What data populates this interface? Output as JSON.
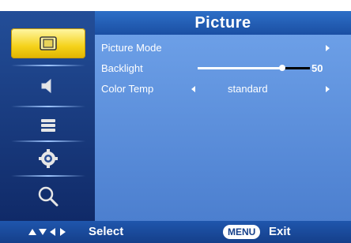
{
  "header": {
    "title": "Picture"
  },
  "sidebar": {
    "items": [
      {
        "icon": "picture-icon",
        "active": true
      },
      {
        "icon": "speaker-icon",
        "active": false
      },
      {
        "icon": "settings-bars-icon",
        "active": false
      },
      {
        "icon": "gear-icon",
        "active": false
      },
      {
        "icon": "search-icon",
        "active": false
      }
    ]
  },
  "menu": {
    "items": [
      {
        "label": "Picture Mode"
      },
      {
        "label": "Backlight",
        "value": "50",
        "level": 0.75
      },
      {
        "label": "Color Temp",
        "value": "standard"
      }
    ]
  },
  "footer": {
    "select_label": "Select",
    "menu_key": "MENU",
    "exit_label": "Exit"
  },
  "colors": {
    "panel": "#5a8fdc",
    "active": "#f5d21a",
    "bar": "#1f56ad"
  }
}
